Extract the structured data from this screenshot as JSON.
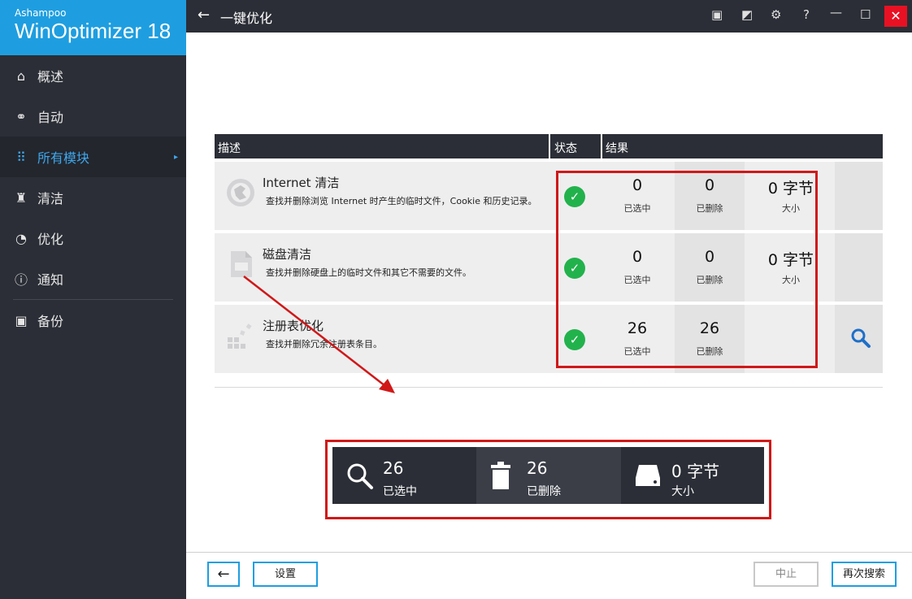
{
  "sidebar": {
    "brand_small": "Ashampoo",
    "brand_big": "WinOptimizer 18",
    "items": [
      {
        "label": "概述"
      },
      {
        "label": "自动"
      },
      {
        "label": "所有模块"
      },
      {
        "label": "清洁"
      },
      {
        "label": "优化"
      },
      {
        "label": "通知"
      },
      {
        "label": "备份"
      }
    ]
  },
  "header": {
    "title": "一键优化"
  },
  "table": {
    "headers": {
      "desc": "描述",
      "status": "状态",
      "result": "结果"
    },
    "rows": [
      {
        "title": "Internet 清洁",
        "desc": "查找并删除浏览 Internet 时产生的临时文件，Cookie 和历史记录。",
        "selected": "0",
        "selected_label": "已选中",
        "deleted": "0",
        "deleted_label": "已删除",
        "size": "0 字节",
        "size_label": "大小"
      },
      {
        "title": "磁盘清洁",
        "desc": "查找并删除硬盘上的临时文件和其它不需要的文件。",
        "selected": "0",
        "selected_label": "已选中",
        "deleted": "0",
        "deleted_label": "已删除",
        "size": "0 字节",
        "size_label": "大小"
      },
      {
        "title": "注册表优化",
        "desc": "查找并删除冗余注册表条目。",
        "selected": "26",
        "selected_label": "已选中",
        "deleted": "26",
        "deleted_label": "已删除"
      }
    ]
  },
  "summary": {
    "selected": "26",
    "selected_label": "已选中",
    "deleted": "26",
    "deleted_label": "已删除",
    "size": "0 字节",
    "size_label": "大小"
  },
  "footer": {
    "settings": "设置",
    "stop": "中止",
    "rescan": "再次搜索"
  },
  "colors": {
    "accent": "#1e9ee0",
    "dark": "#2b2e36",
    "status_ok": "#22b24c",
    "highlight": "#d01818"
  }
}
